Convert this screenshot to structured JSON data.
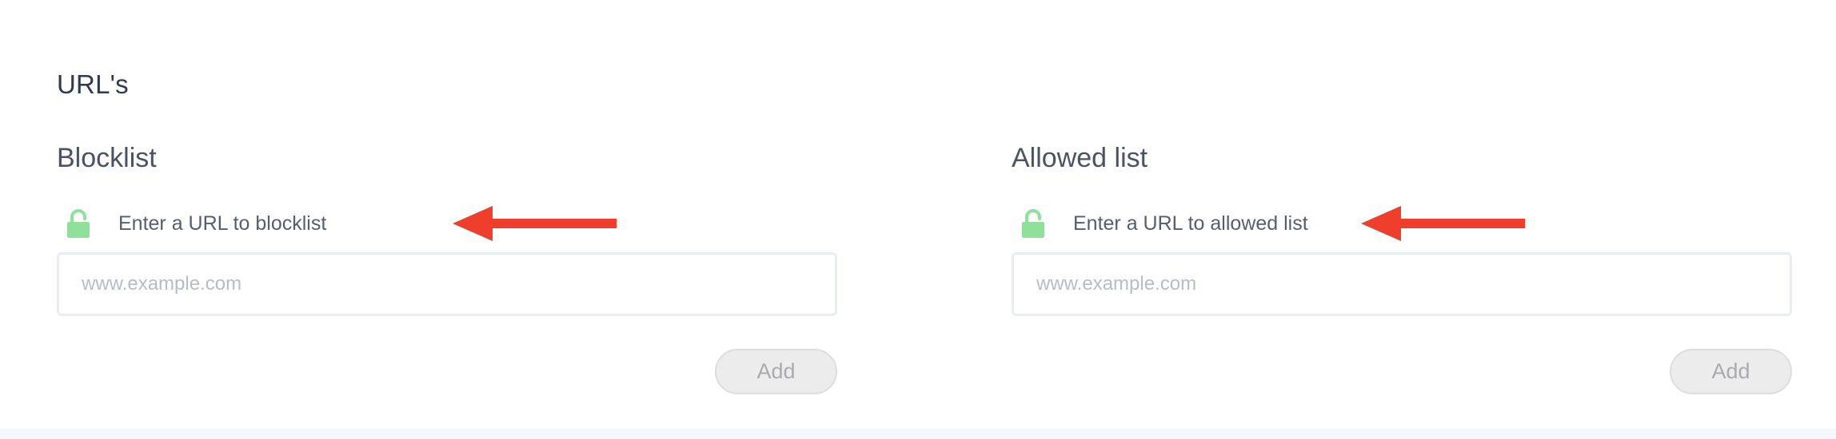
{
  "section": {
    "title": "URL's"
  },
  "blocklist": {
    "title": "Blocklist",
    "prompt": "Enter a URL to blocklist",
    "input_placeholder": "www.example.com",
    "input_value": "",
    "add_label": "Add",
    "lock_icon": "unlocked-padlock-icon",
    "annotation_icon": "red-arrow-left-icon"
  },
  "allowed": {
    "title": "Allowed list",
    "prompt": "Enter a URL to allowed list",
    "input_placeholder": "www.example.com",
    "input_value": "",
    "add_label": "Add",
    "lock_icon": "unlocked-padlock-icon",
    "annotation_icon": "red-arrow-left-icon"
  },
  "colors": {
    "lock_green": "#8fe09a",
    "annotation_red": "#ef3e2c",
    "title_text": "#2f3a52",
    "button_bg": "#ececec",
    "button_text": "#a9abaf"
  }
}
